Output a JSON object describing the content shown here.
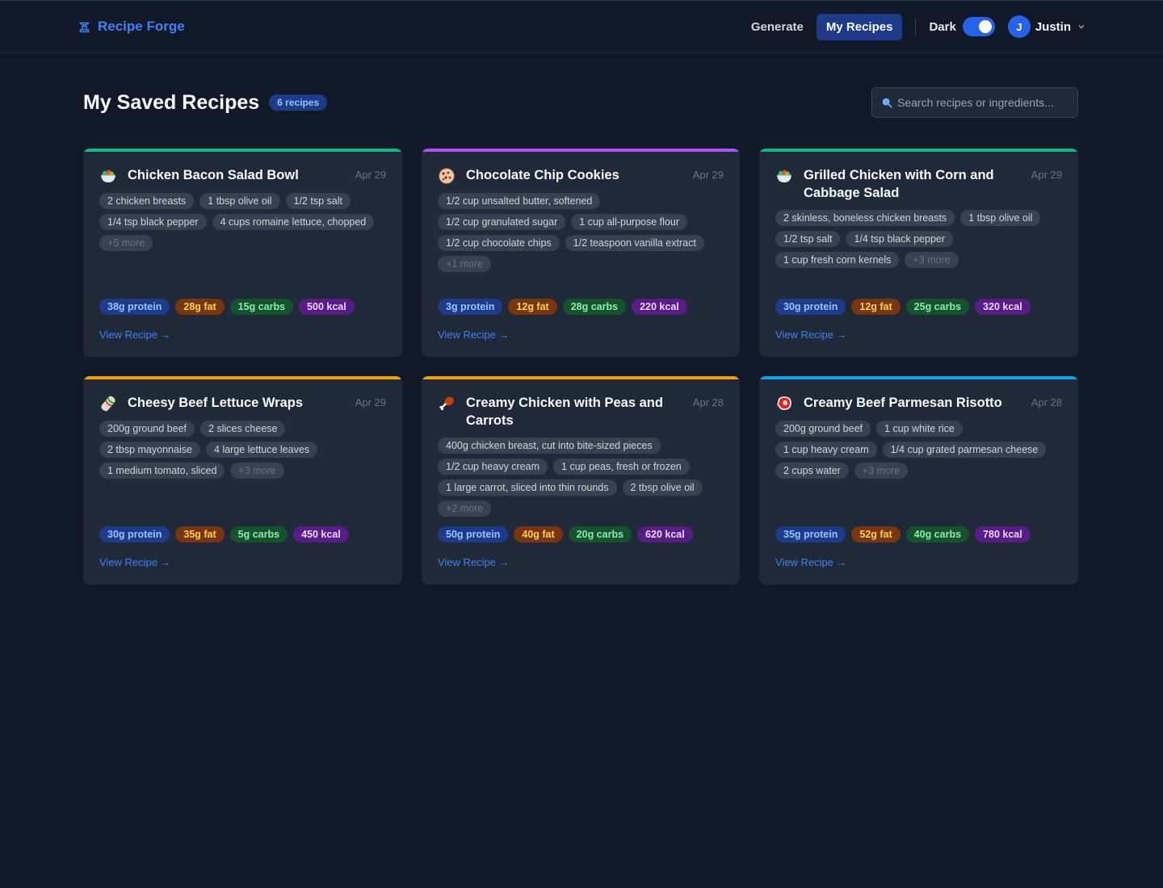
{
  "header": {
    "brand": "Recipe Forge",
    "nav": [
      {
        "label": "Generate",
        "active": false
      },
      {
        "label": "My Recipes",
        "active": true
      }
    ],
    "theme_label": "Dark",
    "theme_on": true,
    "user": {
      "initial": "J",
      "name": "Justin"
    }
  },
  "page": {
    "title": "My Saved Recipes",
    "count_badge": "6 recipes",
    "search_placeholder": "Search recipes or ingredients..."
  },
  "colors": {
    "green": "#10b981",
    "purple": "#8b5cf6",
    "orange": "#f59e0b",
    "blue": "#0ea5e9"
  },
  "recipes": [
    {
      "title": "Chicken Bacon Salad Bowl",
      "date": "Apr 29",
      "icon": "salad-bowl-icon",
      "accent": "#10b981",
      "ingredients": [
        "2 chicken breasts",
        "1 tbsp olive oil",
        "1/2 tsp salt",
        "1/4 tsp black pepper",
        "4 cups romaine lettuce, chopped"
      ],
      "more": "+5 more",
      "protein": "38g protein",
      "fat": "28g fat",
      "carbs": "15g carbs",
      "kcal": "500 kcal",
      "link": "View Recipe →"
    },
    {
      "title": "Chocolate Chip Cookies",
      "date": "Apr 29",
      "icon": "cookie-icon",
      "accent": "#a855f7",
      "ingredients": [
        "1/2 cup unsalted butter, softened",
        "1/2 cup granulated sugar",
        "1 cup all-purpose flour",
        "1/2 cup chocolate chips",
        "1/2 teaspoon vanilla extract"
      ],
      "more": "+1 more",
      "protein": "3g protein",
      "fat": "12g fat",
      "carbs": "28g carbs",
      "kcal": "220 kcal",
      "link": "View Recipe →"
    },
    {
      "title": "Grilled Chicken with Corn and Cabbage Salad",
      "date": "Apr 29",
      "icon": "salad-bowl-icon",
      "accent": "#10b981",
      "ingredients": [
        "2 skinless, boneless chicken breasts",
        "1 tbsp olive oil",
        "1/2 tsp salt",
        "1/4 tsp black pepper",
        "1 cup fresh corn kernels"
      ],
      "more": "+3 more",
      "protein": "30g protein",
      "fat": "12g fat",
      "carbs": "25g carbs",
      "kcal": "320 kcal",
      "link": "View Recipe →"
    },
    {
      "title": "Cheesy Beef Lettuce Wraps",
      "date": "Apr 29",
      "icon": "wrap-icon",
      "accent": "#f59e0b",
      "ingredients": [
        "200g ground beef",
        "2 slices cheese",
        "2 tbsp mayonnaise",
        "4 large lettuce leaves",
        "1 medium tomato, sliced"
      ],
      "more": "+3 more",
      "protein": "30g protein",
      "fat": "35g fat",
      "carbs": "5g carbs",
      "kcal": "450 kcal",
      "link": "View Recipe →"
    },
    {
      "title": "Creamy Chicken with Peas and Carrots",
      "date": "Apr 28",
      "icon": "drumstick-icon",
      "accent": "#f59e0b",
      "ingredients": [
        "400g chicken breast, cut into bite-sized pieces",
        "1/2 cup heavy cream",
        "1 cup peas, fresh or frozen",
        "1 large carrot, sliced into thin rounds",
        "2 tbsp olive oil"
      ],
      "more": "+2 more",
      "protein": "50g protein",
      "fat": "40g fat",
      "carbs": "20g carbs",
      "kcal": "620 kcal",
      "link": "View Recipe →"
    },
    {
      "title": "Creamy Beef Parmesan Risotto",
      "date": "Apr 28",
      "icon": "steak-icon",
      "accent": "#0ea5e9",
      "ingredients": [
        "200g ground beef",
        "1 cup white rice",
        "1 cup heavy cream",
        "1/4 cup grated parmesan cheese",
        "2 cups water"
      ],
      "more": "+3 more",
      "protein": "35g protein",
      "fat": "52g fat",
      "carbs": "40g carbs",
      "kcal": "780 kcal",
      "link": "View Recipe →"
    }
  ]
}
